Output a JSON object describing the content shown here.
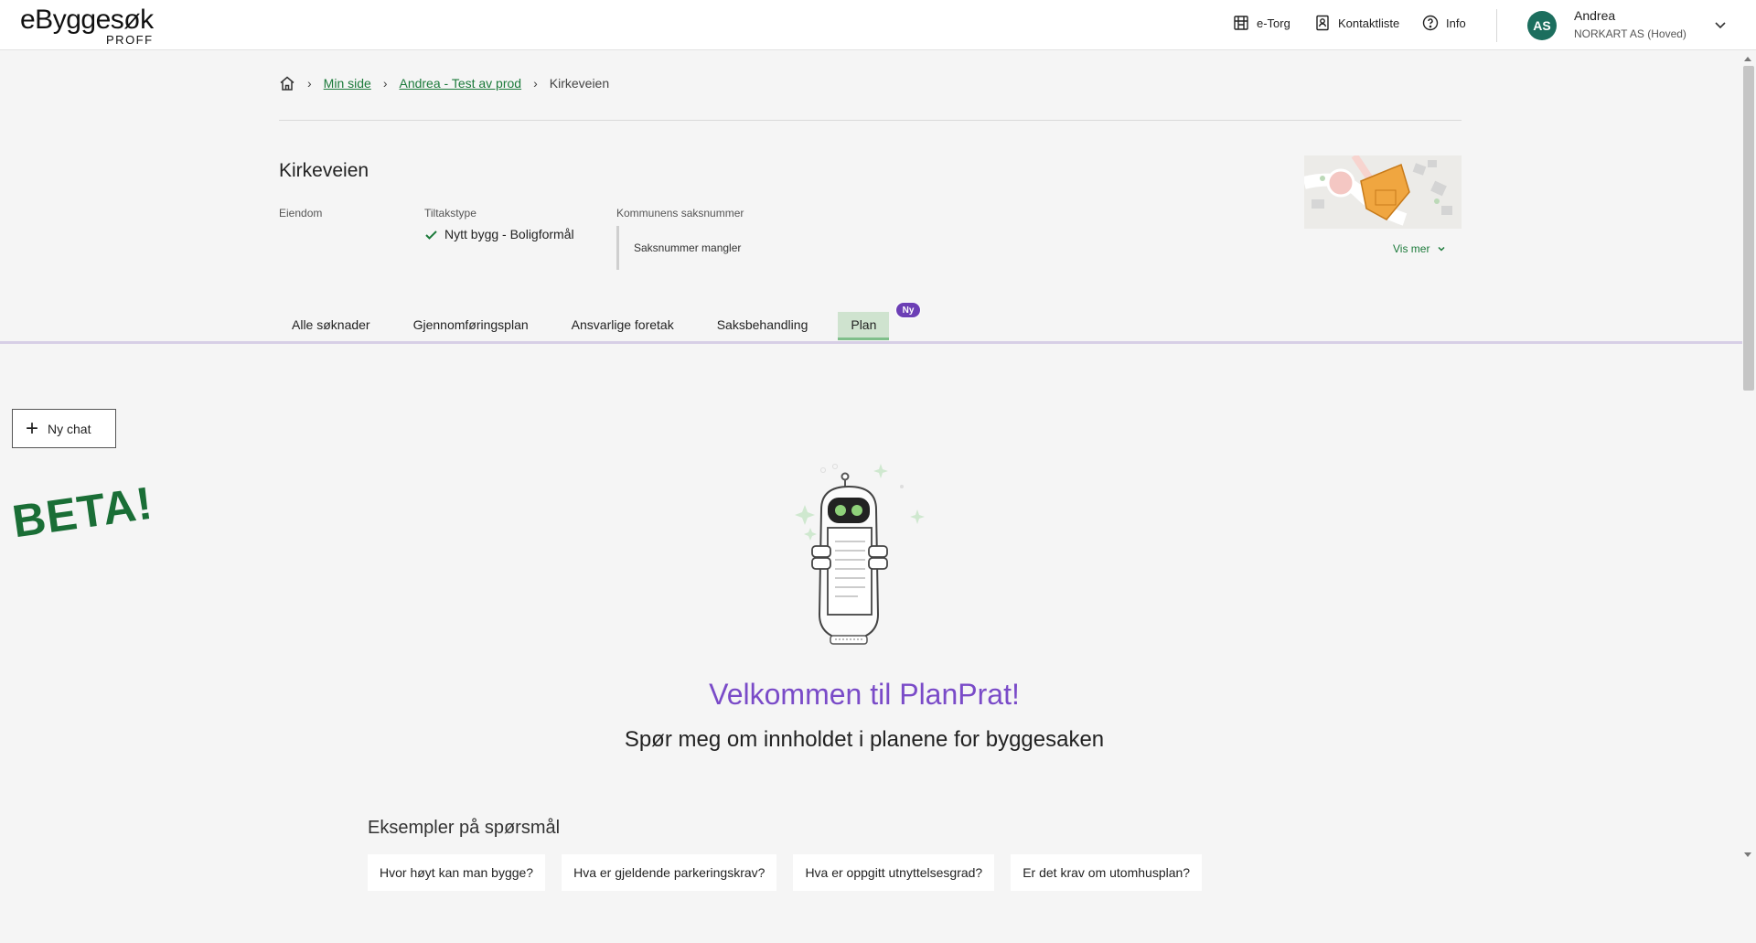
{
  "header": {
    "logo_main": "eByggesøk",
    "logo_sub": "PROFF",
    "nav": [
      {
        "label": "e-Torg",
        "icon": "storefront-icon"
      },
      {
        "label": "Kontaktliste",
        "icon": "contact-book-icon"
      },
      {
        "label": "Info",
        "icon": "help-circle-icon"
      }
    ],
    "user": {
      "initials": "AS",
      "name": "Andrea",
      "org": "NORKART AS (Hoved)"
    }
  },
  "breadcrumb": {
    "items": [
      "Min side",
      "Andrea - Test av prod"
    ],
    "current": "Kirkeveien"
  },
  "project": {
    "title": "Kirkeveien",
    "eiendom_label": "Eiendom",
    "tiltakstype_label": "Tiltakstype",
    "tiltakstype_value": "Nytt bygg - Boligformål",
    "saksnummer_label": "Kommunens saksnummer",
    "saksnummer_value": "Saksnummer mangler",
    "vis_mer": "Vis mer"
  },
  "tabs": [
    {
      "label": "Alle søknader",
      "active": false
    },
    {
      "label": "Gjennomføringsplan",
      "active": false
    },
    {
      "label": "Ansvarlige foretak",
      "active": false
    },
    {
      "label": "Saksbehandling",
      "active": false
    },
    {
      "label": "Plan",
      "active": true
    }
  ],
  "plan_badge": "Ny",
  "chat": {
    "new_chat_label": "Ny chat",
    "beta_label": "BETA!",
    "welcome": "Velkommen til PlanPrat!",
    "subtitle": "Spør meg om innholdet i planene for byggesaken",
    "examples_title": "Eksempler på spørsmål",
    "examples": [
      "Hvor høyt kan man bygge?",
      "Hva er gjeldende parkeringskrav?",
      "Hva er oppgitt utnyttelsesgrad?",
      "Er det krav om utomhusplan?"
    ]
  },
  "colors": {
    "brand_green": "#1b7a3a",
    "accent_purple": "#7a4bc8",
    "badge_purple": "#6c3fb5",
    "avatar_teal": "#1c6e5e",
    "map_parcel": "#f0a640"
  }
}
